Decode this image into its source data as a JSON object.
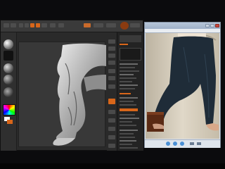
{
  "zbrush": {
    "toolbar_buttons": 12
  },
  "browser": {
    "window_buttons": [
      "minimize-icon",
      "maximize-icon",
      "close-icon"
    ]
  },
  "colors": {
    "zbrush_bg": "#2a2a2a",
    "accent_orange": "#d8661a",
    "browser_chrome": "#d9dfe7",
    "pants": "#1f2c38",
    "backdrop": "#cfc6b4"
  }
}
